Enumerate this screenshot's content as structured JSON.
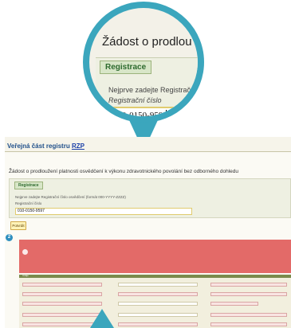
{
  "zoom": {
    "title": "Žádost o prodlou",
    "tag": "Registrace",
    "instruction": "Nejprve zadejte Registrační",
    "field_label": "Registrační číslo",
    "field_value": "010-0150-9597"
  },
  "page": {
    "header_prefix": "Veřejná část registru ",
    "header_link": "RZP",
    "subtitle": "Žádost o prodloužení platnosti osvědčení k výkonu zdravotnického povolání bez odborného dohledu",
    "panel_tag": "Registrace",
    "instruction": "Nejprve zadejte Registrační číslo osvědčení (formát 000-YYYY-ZZZZ)",
    "field_label": "Registrační číslo",
    "field_value": "010-0150-9597",
    "submit_label": "Potvrdit",
    "step_badge": "2"
  },
  "form": {
    "section_label": "Údaje"
  },
  "colors": {
    "accent": "#3ba6bd",
    "error_bg": "#e36a68",
    "panel_bg": "#eef0e2",
    "tag_bg": "#d8e6c8"
  }
}
